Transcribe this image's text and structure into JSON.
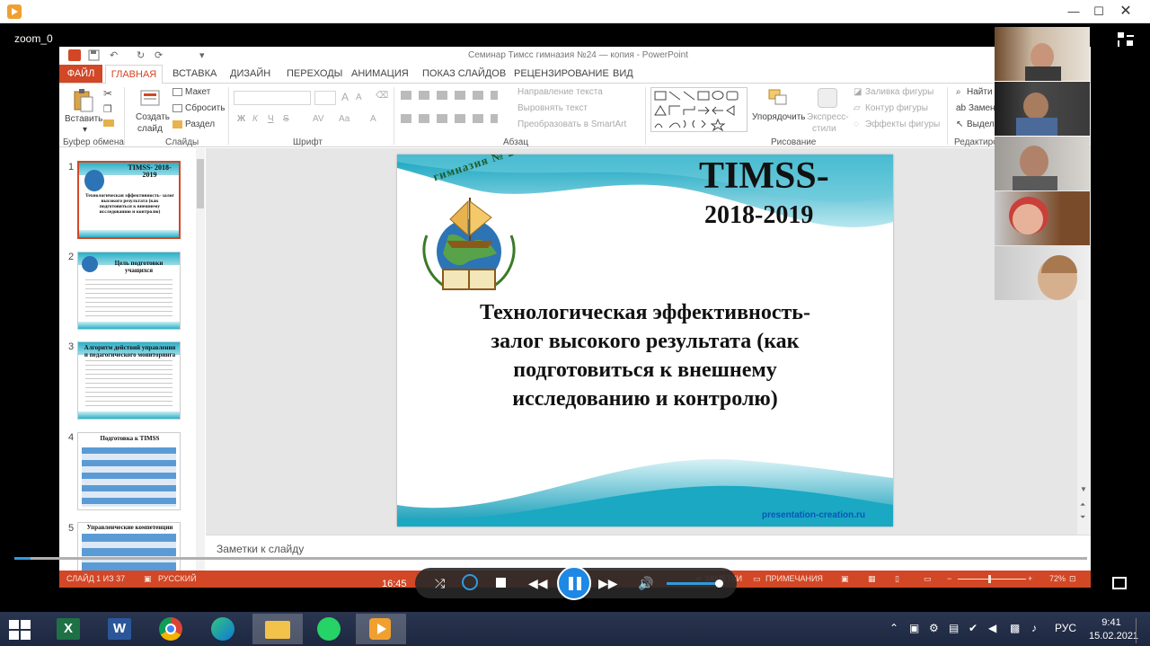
{
  "player": {
    "close_glyph": "✕",
    "minimize_glyph": "—",
    "maximize_glyph": "☐"
  },
  "zoom": {
    "label": "zoom_0"
  },
  "ppt": {
    "window_title": "Семинар Тимсс гимназия №24 — копия - PowerPoint",
    "tabs": [
      {
        "label": "ФАЙЛ"
      },
      {
        "label": "ГЛАВНАЯ"
      },
      {
        "label": "ВСТАВКА"
      },
      {
        "label": "ДИЗАЙН"
      },
      {
        "label": "ПЕРЕХОДЫ"
      },
      {
        "label": "АНИМАЦИЯ"
      },
      {
        "label": "ПОКАЗ СЛАЙДОВ"
      },
      {
        "label": "РЕЦЕНЗИРОВАНИЕ"
      },
      {
        "label": "ВИД"
      }
    ],
    "ribbon": {
      "clipboard": {
        "paste": "Вставить",
        "group": "Буфер обмена"
      },
      "slides": {
        "create_l1": "Создать",
        "create_l2": "слайд",
        "layout": "Макет",
        "reset": "Сбросить",
        "section": "Раздел",
        "group": "Слайды"
      },
      "font": {
        "bold": "Ж",
        "italic": "К",
        "underline": "Ч",
        "strike": "S",
        "spacing": "AV",
        "case": "Аа",
        "group": "Шрифт"
      },
      "paragraph": {
        "text_direction": "Направление текста",
        "align_text": "Выровнять текст",
        "smartart": "Преобразовать в SmartArt",
        "group": "Абзац"
      },
      "drawing": {
        "arrange": "Упорядочить",
        "styles_l1": "Экспресс-",
        "styles_l2": "стили",
        "fill": "Заливка фигуры",
        "outline": "Контур фигуры",
        "effects": "Эффекты фигуры",
        "group": "Рисование"
      },
      "editing": {
        "find": "Найти",
        "replace": "Замен",
        "select": "Выдел",
        "group": "Редактиро"
      }
    },
    "thumbnails": [
      {
        "num": "1",
        "title": "TIMSS- 2018-2019",
        "subtitle": "Технологическая эффективность- залог высокого результата (как подготовиться к внешнему исследованию и контролю)"
      },
      {
        "num": "2",
        "title": "Цель подготовки учащихся"
      },
      {
        "num": "3",
        "title": "Алгоритм действий управления и педагогического мониторинга"
      },
      {
        "num": "4",
        "title": "Подготовка к TIMSS"
      },
      {
        "num": "5",
        "title": "Управленческие компетенции"
      }
    ],
    "slide": {
      "school": "гимназия № 24",
      "title_l1": "TIMSS-",
      "title_l2": "2018-2019",
      "body_l1": "Технологическая эффективность-",
      "body_l2": "залог высокого результата (как",
      "body_l3": "подготовиться к внешнему",
      "body_l4": "исследованию и контролю)",
      "footer": "presentation-creation.ru"
    },
    "notes_label": "Заметки к слайду",
    "status": {
      "slide": "СЛАЙД 1 ИЗ 37",
      "lang": "РУССКИЙ",
      "notes": "ЗАМЕТКИ",
      "comments": "ПРИМЕЧАНИЯ",
      "zoom": "72%"
    }
  },
  "media": {
    "time": "16:45",
    "volume_fraction": 0.97
  },
  "taskbar": {
    "lang": "РУС",
    "time": "9:41",
    "date": "15.02.2021"
  }
}
